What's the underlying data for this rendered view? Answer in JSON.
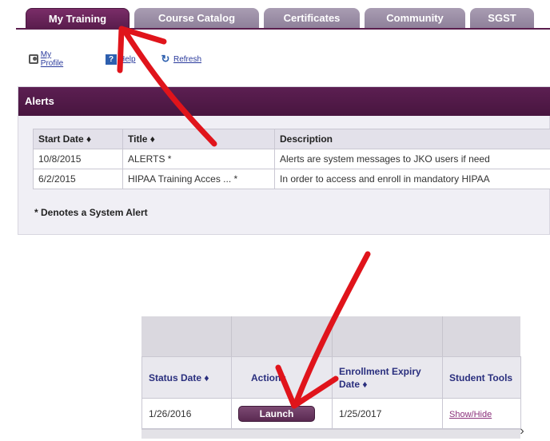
{
  "tabs": [
    {
      "label": "My Training",
      "active": true
    },
    {
      "label": "Course Catalog",
      "active": false
    },
    {
      "label": "Certificates",
      "active": false
    },
    {
      "label": "Community",
      "active": false
    },
    {
      "label": "SGST",
      "active": false
    }
  ],
  "links": {
    "my_profile": "My Profile",
    "help": "Help",
    "refresh": "Refresh"
  },
  "alerts": {
    "header": "Alerts",
    "columns": [
      "Start Date ♦",
      "Title ♦",
      "Description"
    ],
    "rows": [
      {
        "start": "10/8/2015",
        "title": "ALERTS *",
        "description": "Alerts are system messages to JKO users if need"
      },
      {
        "start": "6/2/2015",
        "title": "HIPAA Training Acces ... *",
        "description": "In order to access and enroll in mandatory HIPAA"
      }
    ],
    "note": "* Denotes a System Alert"
  },
  "enrollment": {
    "headers": {
      "status_date": "Status Date ♦",
      "actions": "Actions",
      "expiry": "Enrollment Expiry Date ♦",
      "tools": "Student Tools"
    },
    "row": {
      "status_date": "1/26/2016",
      "launch_label": "Launch",
      "expiry": "1/25/2017",
      "tools_link": "Show/Hide"
    },
    "scroll_arrow": "›"
  },
  "colors": {
    "brand_purple": "#5a1d4d",
    "annotation_red": "#e0141b"
  }
}
